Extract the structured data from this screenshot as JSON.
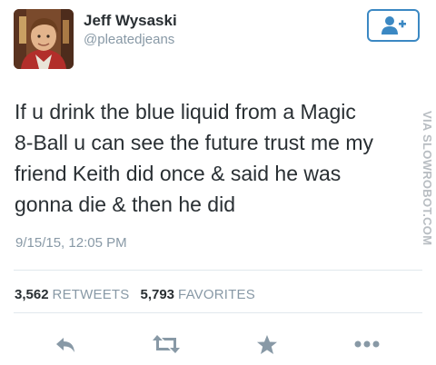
{
  "profile": {
    "display_name": "Jeff Wysaski",
    "handle": "@pleatedjeans"
  },
  "tweet": {
    "lines": [
      "If u drink the blue liquid from a Magic",
      "8-Ball u can see the future trust me my",
      "friend Keith did once & said he was",
      "gonna die & then he did"
    ],
    "timestamp": "9/15/15, 12:05 PM"
  },
  "stats": {
    "retweets_count": "3,562",
    "retweets_label": "RETWEETS",
    "favorites_count": "5,793",
    "favorites_label": "FAVORITES"
  },
  "watermark": "VIA SLOWROBOT.COM",
  "icons": {
    "follow": "add-user-icon",
    "reply": "reply-icon",
    "retweet": "retweet-icon",
    "favorite": "star-icon",
    "more": "more-icon"
  },
  "colors": {
    "text": "#292f33",
    "muted": "#8899a6",
    "follow_blue": "#3b88c3",
    "action_icon": "#8899a6"
  }
}
